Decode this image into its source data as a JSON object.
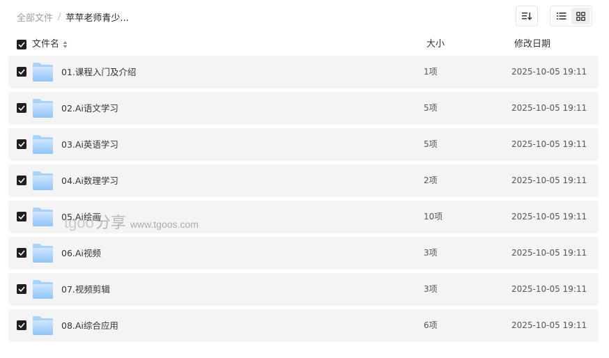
{
  "breadcrumb": {
    "root": "全部文件",
    "separator": "/",
    "current": "苹苹老师青少..."
  },
  "toolbar": {
    "sort_icon": "sort-icon",
    "view_modes": [
      "list-view-icon",
      "grid-view-icon"
    ],
    "active_view": "list"
  },
  "table": {
    "headers": {
      "name": "文件名",
      "size": "大小",
      "date": "修改日期"
    },
    "select_all_checked": true,
    "rows": [
      {
        "name": "01.课程入门及介绍",
        "size": "1项",
        "date": "2025-10-05 19:11",
        "checked": true,
        "icon": "folder-icon"
      },
      {
        "name": "02.Ai语文学习",
        "size": "5项",
        "date": "2025-10-05 19:11",
        "checked": true,
        "icon": "folder-icon"
      },
      {
        "name": "03.Ai英语学习",
        "size": "5项",
        "date": "2025-10-05 19:11",
        "checked": true,
        "icon": "folder-icon"
      },
      {
        "name": "04.Ai数理学习",
        "size": "2项",
        "date": "2025-10-05 19:11",
        "checked": true,
        "icon": "folder-icon"
      },
      {
        "name": "05.Ai绘画",
        "size": "10项",
        "date": "2025-10-05 19:11",
        "checked": true,
        "icon": "folder-icon"
      },
      {
        "name": "06.Ai视频",
        "size": "3项",
        "date": "2025-10-05 19:11",
        "checked": true,
        "icon": "folder-icon"
      },
      {
        "name": "07.视频剪辑",
        "size": "3项",
        "date": "2025-10-05 19:11",
        "checked": true,
        "icon": "folder-icon"
      },
      {
        "name": "08.Ai综合应用",
        "size": "6项",
        "date": "2025-10-05 19:11",
        "checked": true,
        "icon": "folder-icon"
      }
    ]
  },
  "watermark": {
    "brand": "tgoo",
    "share": "分享",
    "url": "www.tgoos.com"
  },
  "colors": {
    "row_background": "#f4f4f5",
    "checkbox": "#1f1f23",
    "folder_light": "#cfe6ff",
    "folder_dark": "#7bbcf7",
    "muted_text": "#9aa0a6"
  }
}
